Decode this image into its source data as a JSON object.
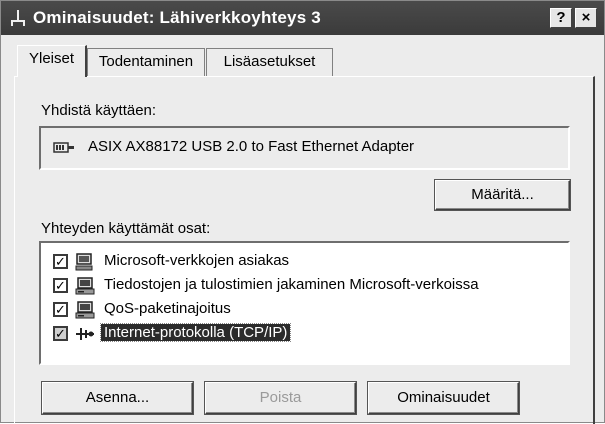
{
  "window": {
    "title": "Ominaisuudet: Lähiverkkoyhteys 3",
    "help_label": "?",
    "close_label": "×"
  },
  "tabs": [
    {
      "label": "Yleiset",
      "active": true
    },
    {
      "label": "Todentaminen",
      "active": false
    },
    {
      "label": "Lisäasetukset",
      "active": false
    }
  ],
  "general": {
    "connect_using_label": "Yhdistä käyttäen:",
    "adapter_name": "ASIX AX88172 USB 2.0 to Fast Ethernet Adapter",
    "configure_label": "Määritä...",
    "components_label": "Yhteyden käyttämät osat:",
    "components": [
      {
        "label": "Microsoft-verkkojen asiakas",
        "checked": true,
        "icon": "network-client-icon"
      },
      {
        "label": "Tiedostojen ja tulostimien jakaminen Microsoft-verkoissa",
        "checked": true,
        "icon": "network-service-icon"
      },
      {
        "label": "QoS-paketinajoitus",
        "checked": true,
        "icon": "network-service-icon"
      },
      {
        "label": "Internet-protokolla (TCP/IP)",
        "checked": true,
        "icon": "protocol-icon",
        "selected": true
      }
    ],
    "check_mark": "✓"
  },
  "buttons": {
    "install": "Asenna...",
    "remove": "Poista",
    "properties": "Ominaisuudet"
  }
}
